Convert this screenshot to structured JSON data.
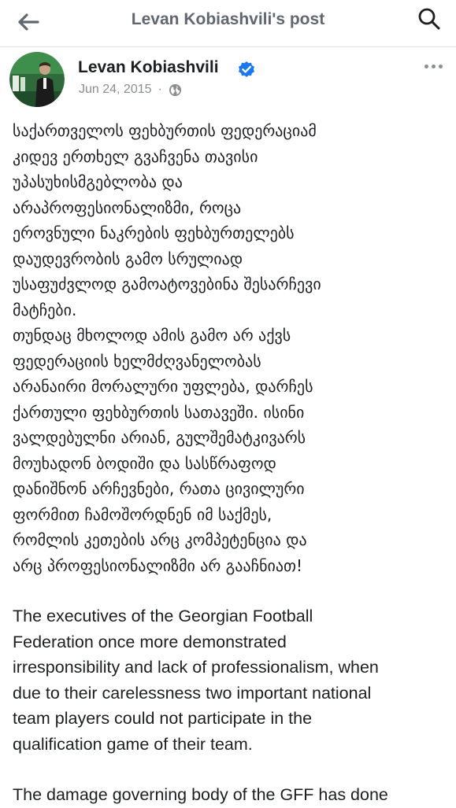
{
  "header": {
    "title": "Levan Kobiashvili's post",
    "back_icon": "arrow-left-icon",
    "search_icon": "search-icon"
  },
  "post": {
    "author": "Levan Kobiashvili",
    "verified_icon": "verified-badge-icon",
    "date": "Jun 24, 2015",
    "separator": "·",
    "audience_icon": "globe-icon",
    "more_icon": "more-horizontal-icon",
    "georgian_lines_1": [
      "საქართველოს ფეხბურთის ფედერაციამ",
      "კიდევ ერთხელ გვაჩვენა თავისი",
      "უპასუხისმგებლობა და",
      "არაპროფესიონალიზმი, როცა",
      "ეროვნული ნაკრების ფეხბურთელებს",
      "დაუდევრობის გამო სრულიად",
      "უსაფუძვლოდ გამოატოვებინა შესარჩევი",
      "მატჩები."
    ],
    "georgian_lines_2": [
      "თუნდაც მხოლოდ ამის გამო არ აქვს",
      "ფედერაციის ხელმძღვანელობას",
      "არანაირი მორალური უფლება, დარჩეს",
      "ქართული ფეხბურთის სათავეში. ისინი",
      "ვალდებულნი არიან, გულშემატკივარს",
      "მოუხადონ ბოდიში და სასწრაფოდ",
      "დანიშნონ არჩევნები, რათა ცივილური",
      "ფორმით ჩამოშორდნენ იმ საქმეს,",
      "რომლის კეთების არც კომპეტენცია და",
      "არც პროფესიონალიზმი არ გააჩნიათ!"
    ],
    "english_lines_1": [
      "The executives of the Georgian Football",
      "Federation once more demonstrated",
      "irresponsibility and lack of professionalism, when",
      "due to their carelessness two important national",
      "team players could not participate in the",
      "qualification game of their team."
    ],
    "english_lines_2": [
      "The damage governing body of the GFF has done"
    ]
  },
  "colors": {
    "verified": "#1877f2",
    "secondary_text": "#8a8d91",
    "title_text": "#606770"
  }
}
